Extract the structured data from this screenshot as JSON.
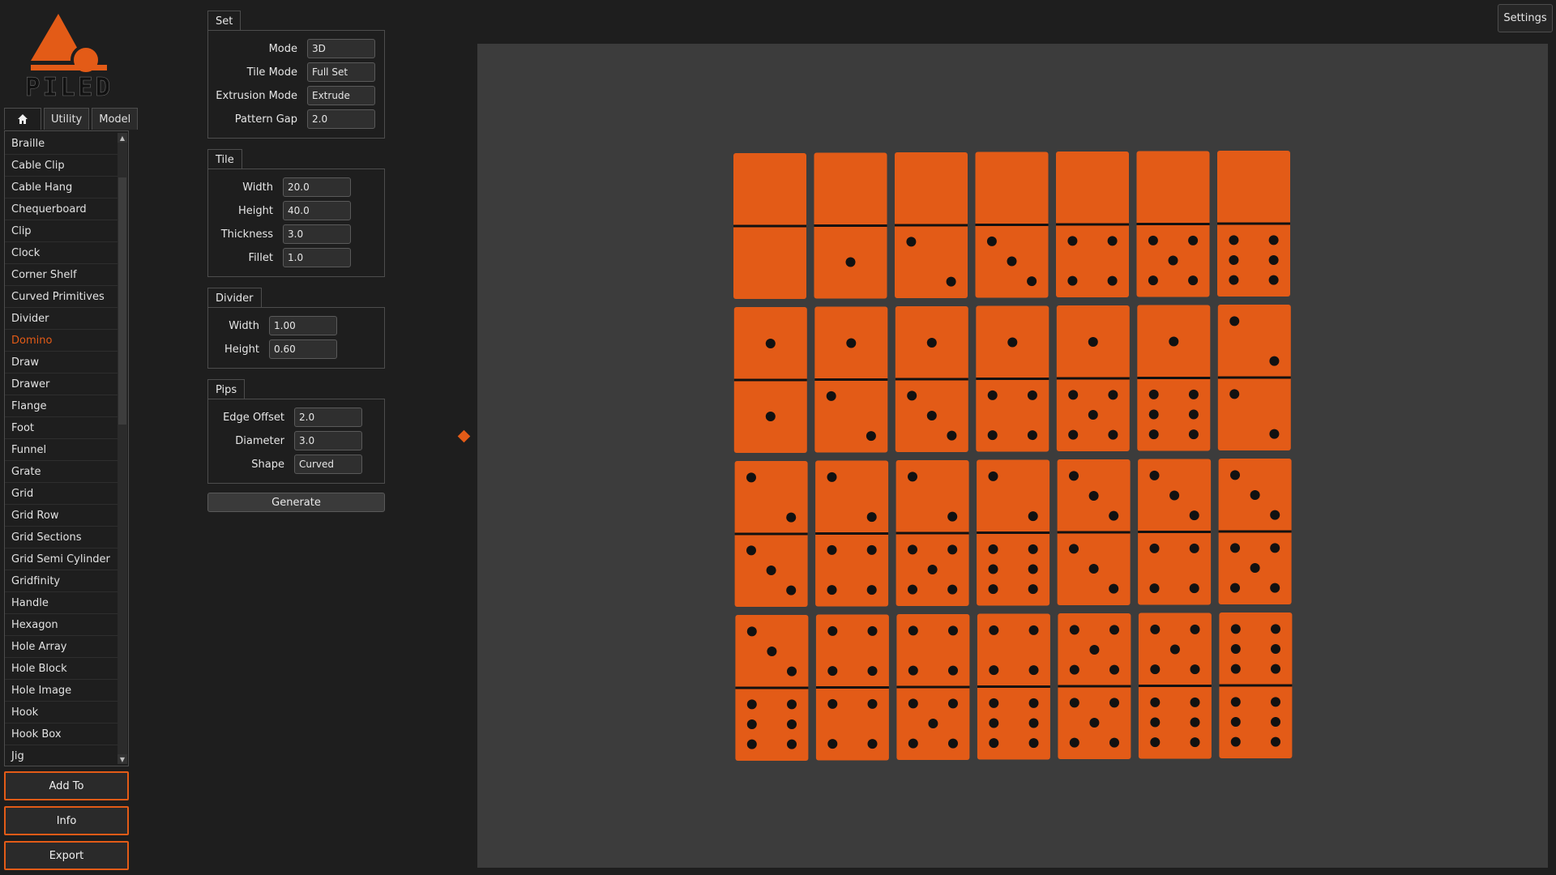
{
  "app": {
    "logo_text": "PILED",
    "accent_color": "#e35b17"
  },
  "tabs": [
    {
      "label": "",
      "icon": "home-icon"
    },
    {
      "label": "Utility"
    },
    {
      "label": "Model"
    }
  ],
  "modules": [
    "Braille",
    "Cable Clip",
    "Cable Hang",
    "Chequerboard",
    "Clip",
    "Clock",
    "Corner Shelf",
    "Curved Primitives",
    "Divider",
    "Domino",
    "Draw",
    "Drawer",
    "Flange",
    "Foot",
    "Funnel",
    "Grate",
    "Grid",
    "Grid Row",
    "Grid Sections",
    "Grid Semi Cylinder",
    "Gridfinity",
    "Handle",
    "Hexagon",
    "Hole Array",
    "Hole Block",
    "Hole Image",
    "Hook",
    "Hook Box",
    "Jig"
  ],
  "selected_module": "Domino",
  "buttons": {
    "add_to": "Add To",
    "info": "Info",
    "export": "Export",
    "generate": "Generate",
    "settings": "Settings"
  },
  "params": {
    "set": {
      "title": "Set",
      "fields": [
        {
          "label": "Mode",
          "value": "3D"
        },
        {
          "label": "Tile Mode",
          "value": "Full Set"
        },
        {
          "label": "Extrusion Mode",
          "value": "Extrude"
        },
        {
          "label": "Pattern Gap",
          "value": "2.0"
        }
      ]
    },
    "tile": {
      "title": "Tile",
      "fields": [
        {
          "label": "Width",
          "value": "20.0"
        },
        {
          "label": "Height",
          "value": "40.0"
        },
        {
          "label": "Thickness",
          "value": "3.0"
        },
        {
          "label": "Fillet",
          "value": "1.0"
        }
      ]
    },
    "divider": {
      "title": "Divider",
      "fields": [
        {
          "label": "Width",
          "value": "1.00"
        },
        {
          "label": "Height",
          "value": "0.60"
        }
      ]
    },
    "pips": {
      "title": "Pips",
      "fields": [
        {
          "label": "Edge Offset",
          "value": "2.0"
        },
        {
          "label": "Diameter",
          "value": "3.0"
        },
        {
          "label": "Shape",
          "value": "Curved"
        }
      ]
    }
  },
  "dominoes": {
    "tile_color": "#e35b17",
    "pip_color": "#111111",
    "tiles": [
      [
        0,
        0
      ],
      [
        0,
        1
      ],
      [
        0,
        2
      ],
      [
        0,
        3
      ],
      [
        0,
        4
      ],
      [
        0,
        5
      ],
      [
        0,
        6
      ],
      [
        1,
        1
      ],
      [
        1,
        2
      ],
      [
        1,
        3
      ],
      [
        1,
        4
      ],
      [
        1,
        5
      ],
      [
        1,
        6
      ],
      [
        2,
        2
      ],
      [
        2,
        3
      ],
      [
        2,
        4
      ],
      [
        2,
        5
      ],
      [
        2,
        6
      ],
      [
        3,
        3
      ],
      [
        3,
        4
      ],
      [
        3,
        5
      ],
      [
        3,
        6
      ],
      [
        4,
        4
      ],
      [
        4,
        5
      ],
      [
        4,
        6
      ],
      [
        5,
        5
      ],
      [
        5,
        6
      ],
      [
        6,
        6
      ]
    ]
  }
}
